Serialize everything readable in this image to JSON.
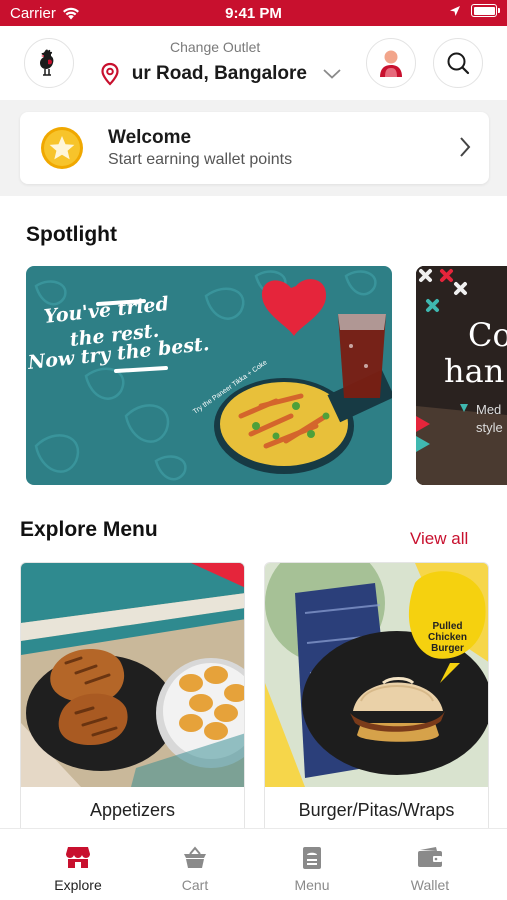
{
  "status_bar": {
    "carrier": "Carrier",
    "time": "9:41 PM"
  },
  "header": {
    "change_outlet_label": "Change Outlet",
    "outlet_address": "ur Road, Bangalore"
  },
  "welcome": {
    "title": "Welcome",
    "subtitle": "Start earning wallet points"
  },
  "spotlight": {
    "title": "Spotlight",
    "banner1": {
      "line1": "You've tried",
      "line2": "the rest.",
      "line3": "Now try the best.",
      "tagline": "Try the Paneer Tikka + Coke"
    },
    "banner2": {
      "line1": "Co",
      "line2": "han",
      "line3": "Med",
      "line4": "style"
    }
  },
  "explore_menu": {
    "title": "Explore Menu",
    "view_all": "View all",
    "items": [
      {
        "name": "Appetizers"
      },
      {
        "name": "Burger/Pitas/Wraps",
        "image_label_1": "Pulled",
        "image_label_2": "Chicken",
        "image_label_3": "Burger"
      }
    ]
  },
  "tabbar": {
    "tabs": [
      {
        "label": "Explore",
        "icon": "store-icon"
      },
      {
        "label": "Cart",
        "icon": "cart-icon"
      },
      {
        "label": "Menu",
        "icon": "menu-icon"
      },
      {
        "label": "Wallet",
        "icon": "wallet-icon"
      }
    ]
  },
  "colors": {
    "brand": "#c8102e",
    "gold": "#f5b800",
    "teal": "#2e7f86"
  }
}
